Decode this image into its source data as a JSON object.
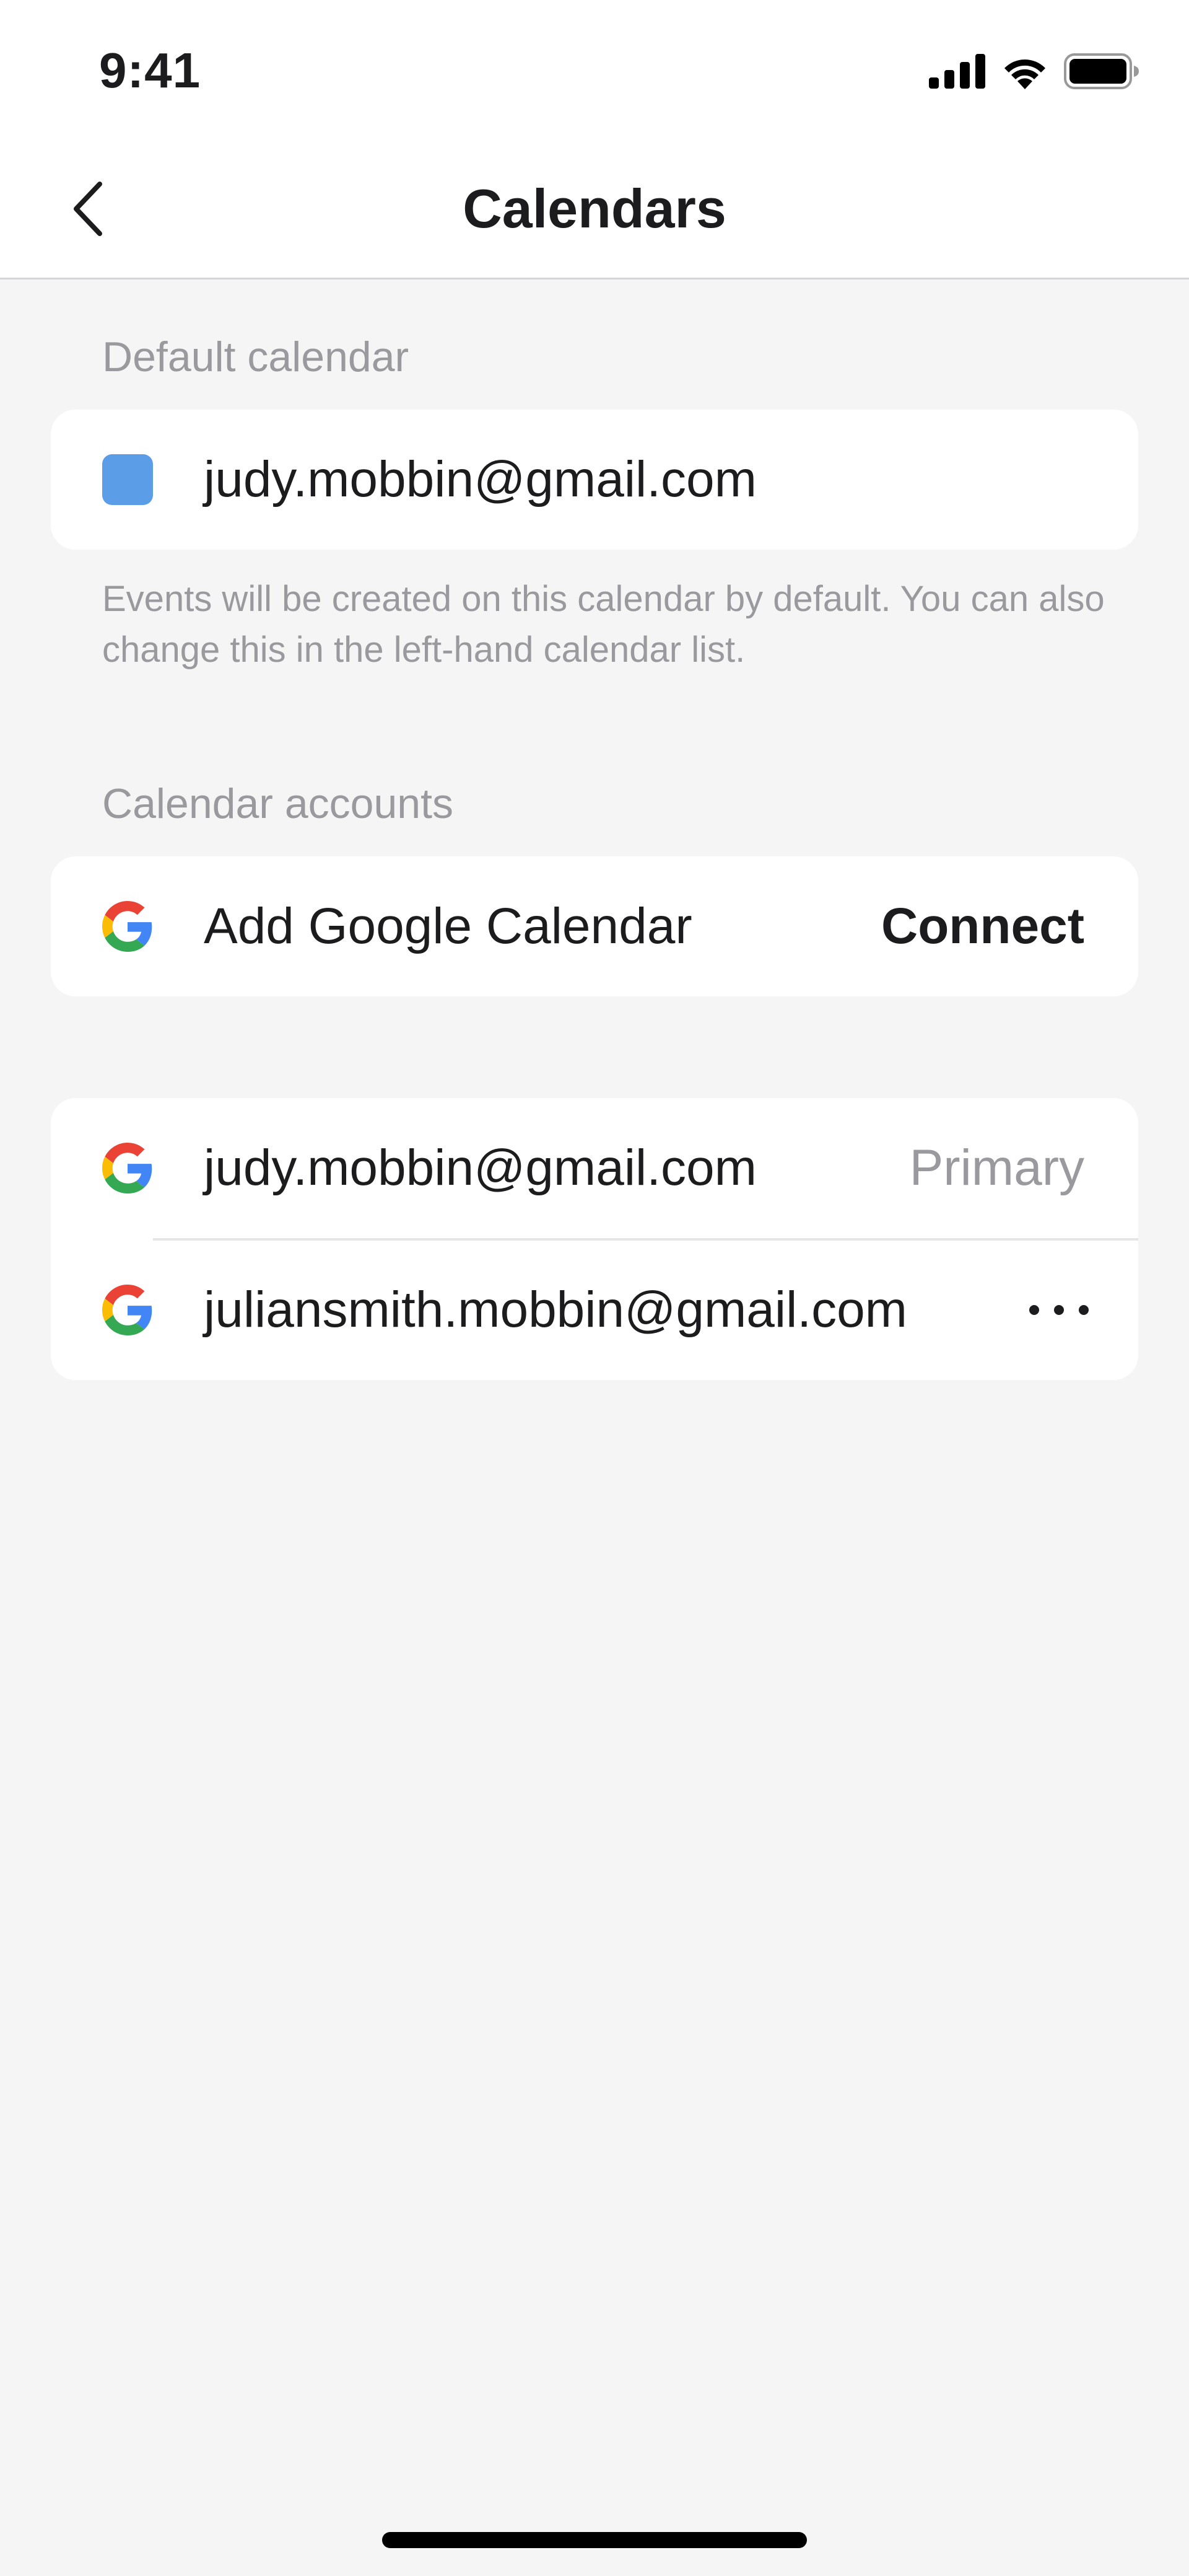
{
  "status_bar": {
    "time": "9:41",
    "icons": [
      "cellular-signal-icon",
      "wifi-icon",
      "battery-icon"
    ]
  },
  "nav": {
    "back_icon": "chevron-left-icon",
    "title": "Calendars"
  },
  "default_calendar": {
    "section_label": "Default calendar",
    "account": "judy.mobbin@gmail.com",
    "swatch_color": "#5B9DE6",
    "helper_text": "Events will be created on this calendar by default. You can also change this in the left-hand calendar list."
  },
  "calendar_accounts": {
    "section_label": "Calendar accounts",
    "add_row": {
      "icon": "google-g-icon",
      "label": "Add Google Calendar",
      "action_label": "Connect"
    },
    "accounts": [
      {
        "icon": "google-g-icon",
        "email": "judy.mobbin@gmail.com",
        "badge": "Primary"
      },
      {
        "icon": "google-g-icon",
        "email": "juliansmith.mobbin@gmail.com",
        "action_icon": "more-horizontal-icon"
      }
    ]
  },
  "colors": {
    "background": "#F5F5F5",
    "card": "#FFFFFF",
    "text_primary": "#1C1C1E",
    "text_secondary": "#9A9A9E",
    "google_blue": "#4285F4",
    "google_red": "#EA4335",
    "google_yellow": "#FBBC05",
    "google_green": "#34A853"
  }
}
